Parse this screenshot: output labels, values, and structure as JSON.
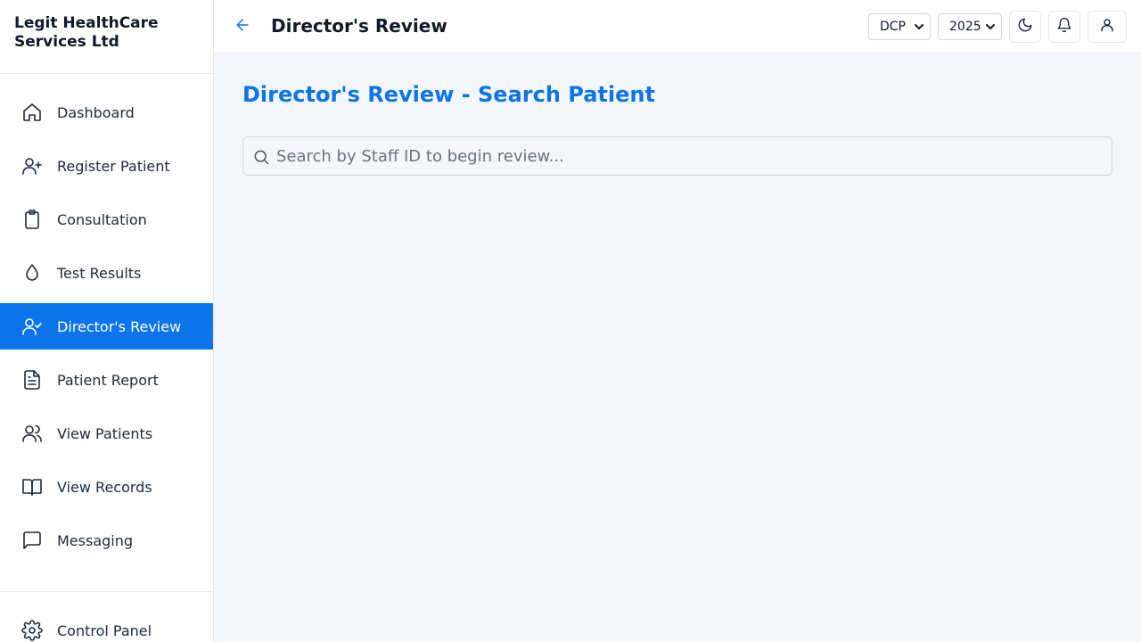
{
  "app": {
    "name": "Legit HealthCare Services Ltd"
  },
  "header": {
    "title": "Director's Review",
    "department_select": {
      "value": "DCP",
      "options": [
        "DCP"
      ]
    },
    "year_select": {
      "value": "2025",
      "options": [
        "2025"
      ]
    }
  },
  "sidebar": {
    "items": [
      {
        "label": "Dashboard",
        "icon": "home-icon"
      },
      {
        "label": "Register Patient",
        "icon": "user-plus-icon"
      },
      {
        "label": "Consultation",
        "icon": "clipboard-icon"
      },
      {
        "label": "Test Results",
        "icon": "droplet-icon"
      },
      {
        "label": "Director's Review",
        "icon": "user-check-icon",
        "active": true
      },
      {
        "label": "Patient Report",
        "icon": "file-text-icon"
      },
      {
        "label": "View Patients",
        "icon": "users-icon"
      },
      {
        "label": "View Records",
        "icon": "book-open-icon"
      },
      {
        "label": "Messaging",
        "icon": "message-square-icon"
      }
    ],
    "bottom": {
      "label": "Control Panel",
      "icon": "gear-icon"
    }
  },
  "main": {
    "heading": "Director's Review - Search Patient",
    "search": {
      "placeholder": "Search by Staff ID to begin review...",
      "value": ""
    }
  },
  "colors": {
    "accent": "#0b74ea",
    "background": "#f3f6fb"
  }
}
